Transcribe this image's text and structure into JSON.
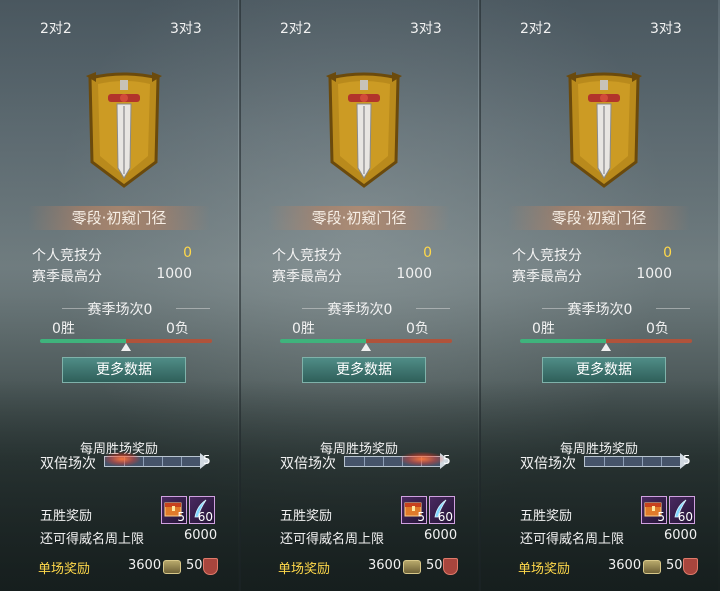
{
  "panels": [
    {
      "modes": {
        "left": "2对2",
        "right": "3对3"
      },
      "rank_title": "零段·初窥门径",
      "personal_score_label": "个人竞技分",
      "personal_score": "0",
      "season_best_label": "赛季最高分",
      "season_best": "1000",
      "season_matches": "赛季场次0",
      "wins": "0胜",
      "losses": "0负",
      "more_data": "更多数据",
      "weekly_title": "每周胜场奖励",
      "double_label": "双倍场次",
      "double_count": "5",
      "five_win_label": "五胜奖励",
      "reward_items": [
        {
          "icon": "chest-icon",
          "count": "5"
        },
        {
          "icon": "feather-icon",
          "count": "60"
        }
      ],
      "limit_label": "还可得威名周上限",
      "limit_value": "6000",
      "single_label": "单场奖励",
      "single_coin": "3600",
      "single_honor": "50"
    },
    {
      "modes": {
        "left": "2对2",
        "right": "3对3"
      },
      "rank_title": "零段·初窥门径",
      "personal_score_label": "个人竞技分",
      "personal_score": "0",
      "season_best_label": "赛季最高分",
      "season_best": "1000",
      "season_matches": "赛季场次0",
      "wins": "0胜",
      "losses": "0负",
      "more_data": "更多数据",
      "weekly_title": "每周胜场奖励",
      "double_label": "双倍场次",
      "double_count": "5",
      "five_win_label": "五胜奖励",
      "reward_items": [
        {
          "icon": "chest-icon",
          "count": "5"
        },
        {
          "icon": "feather-icon",
          "count": "60"
        }
      ],
      "limit_label": "还可得威名周上限",
      "limit_value": "6000",
      "single_label": "单场奖励",
      "single_coin": "3600",
      "single_honor": "50"
    },
    {
      "modes": {
        "left": "2对2",
        "right": "3对3"
      },
      "rank_title": "零段·初窥门径",
      "personal_score_label": "个人竞技分",
      "personal_score": "0",
      "season_best_label": "赛季最高分",
      "season_best": "1000",
      "season_matches": "赛季场次0",
      "wins": "0胜",
      "losses": "0负",
      "more_data": "更多数据",
      "weekly_title": "每周胜场奖励",
      "double_label": "双倍场次",
      "double_count": "5",
      "five_win_label": "五胜奖励",
      "reward_items": [
        {
          "icon": "chest-icon",
          "count": "5"
        },
        {
          "icon": "feather-icon",
          "count": "60"
        }
      ],
      "limit_label": "还可得威名周上限",
      "limit_value": "6000",
      "single_label": "单场奖励",
      "single_coin": "3600",
      "single_honor": "50"
    }
  ],
  "win_ratio_marker": 0.5,
  "colors": {
    "accent_yellow": "#ffd84a",
    "win_bar": "#3fb37c",
    "loss_bar": "#b0533b",
    "button": "#3f766f"
  }
}
